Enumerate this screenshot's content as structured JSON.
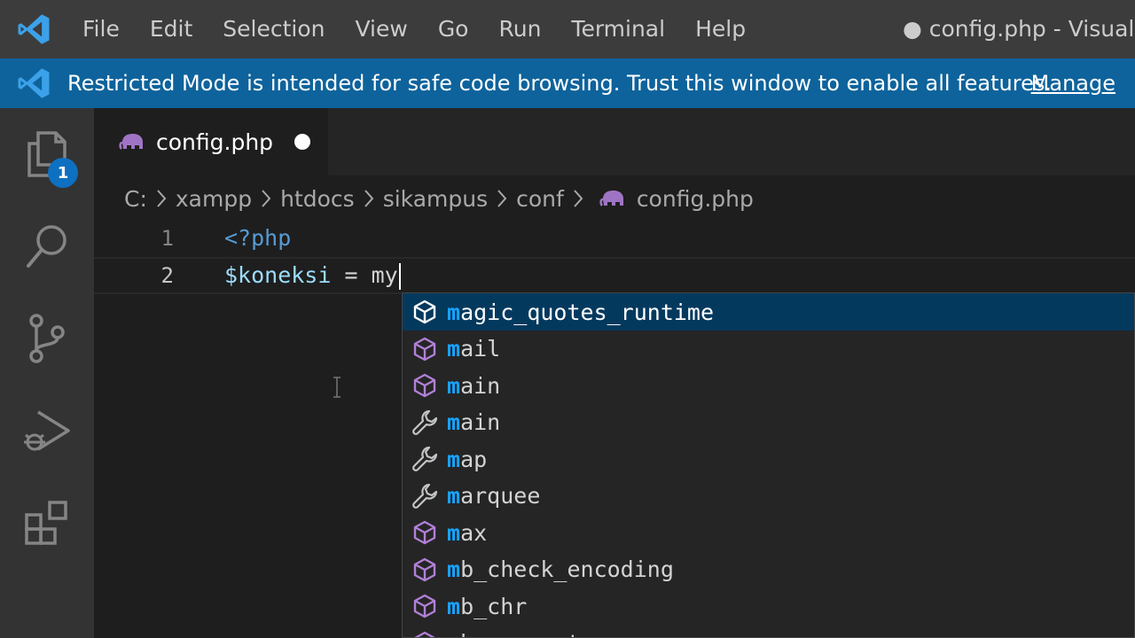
{
  "titlebar": {
    "menu": [
      "File",
      "Edit",
      "Selection",
      "View",
      "Go",
      "Run",
      "Terminal",
      "Help"
    ],
    "window_title": "● config.php - Visual Studio Code"
  },
  "banner": {
    "text": "Restricted Mode is intended for safe code browsing. Trust this window to enable all features.",
    "link": "Manage"
  },
  "activity": {
    "items": [
      "explorer-icon",
      "search-icon",
      "source-control-icon",
      "run-debug-icon",
      "extensions-icon"
    ],
    "explorer_badge": "1"
  },
  "tab": {
    "label": "config.php"
  },
  "breadcrumb": [
    "C:",
    "xampp",
    "htdocs",
    "sikampus",
    "conf",
    "config.php"
  ],
  "editor": {
    "lines": [
      {
        "number": "1",
        "text": "<?php"
      },
      {
        "number": "2",
        "var": "$koneksi",
        "rest": " = my"
      }
    ]
  },
  "suggestions": {
    "typed": "m",
    "items": [
      {
        "label": "magic_quotes_runtime",
        "kind": "cube-icon"
      },
      {
        "label": "mail",
        "kind": "cube-icon"
      },
      {
        "label": "main",
        "kind": "cube-icon"
      },
      {
        "label": "main",
        "kind": "wrench-icon"
      },
      {
        "label": "map",
        "kind": "wrench-icon"
      },
      {
        "label": "marquee",
        "kind": "wrench-icon"
      },
      {
        "label": "max",
        "kind": "cube-icon"
      },
      {
        "label": "mb_check_encoding",
        "kind": "cube-icon"
      },
      {
        "label": "mb_chr",
        "kind": "cube-icon"
      },
      {
        "label": "mb_convert_case",
        "kind": "cube-icon"
      }
    ]
  },
  "colors": {
    "titlebar": "#3c3c3c",
    "banner": "#0e639c",
    "accent": "#18a3ff",
    "selected_row": "#04395e"
  }
}
